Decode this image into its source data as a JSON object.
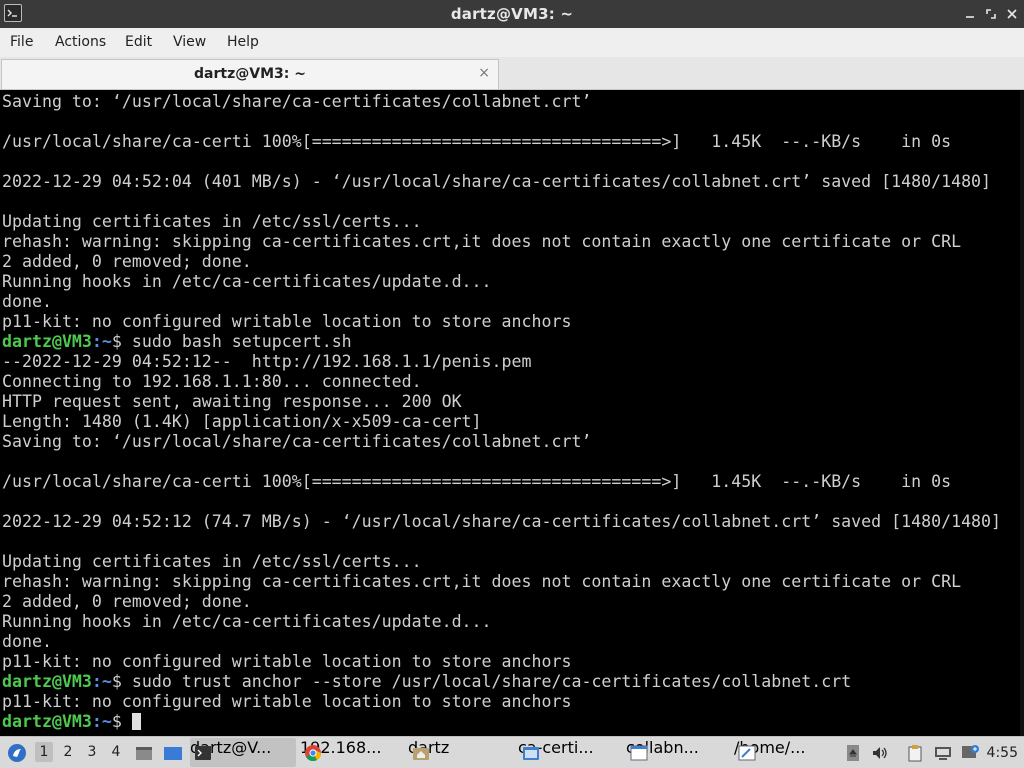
{
  "window": {
    "title": "dartz@VM3: ~"
  },
  "menubar": {
    "items": [
      "File",
      "Actions",
      "Edit",
      "View",
      "Help"
    ]
  },
  "tab": {
    "label": "dartz@VM3: ~",
    "close": "×"
  },
  "terminal": {
    "prompt_user": "dartz@VM3",
    "prompt_path": ":~",
    "prompt_symbol": "$ ",
    "lines": [
      {
        "text": "Saving to: ‘/usr/local/share/ca-certificates/collabnet.crt’"
      },
      {
        "text": ""
      },
      {
        "text": "/usr/local/share/ca-certi 100%[===================================>]   1.45K  --.-KB/s    in 0s"
      },
      {
        "text": ""
      },
      {
        "text": "2022-12-29 04:52:04 (401 MB/s) - ‘/usr/local/share/ca-certificates/collabnet.crt’ saved [1480/1480]"
      },
      {
        "text": ""
      },
      {
        "text": "Updating certificates in /etc/ssl/certs..."
      },
      {
        "text": "rehash: warning: skipping ca-certificates.crt,it does not contain exactly one certificate or CRL"
      },
      {
        "text": "2 added, 0 removed; done."
      },
      {
        "text": "Running hooks in /etc/ca-certificates/update.d..."
      },
      {
        "text": "done."
      },
      {
        "text": "p11-kit: no configured writable location to store anchors"
      },
      {
        "prompt": true,
        "text": "sudo bash setupcert.sh"
      },
      {
        "text": "--2022-12-29 04:52:12--  http://192.168.1.1/penis.pem"
      },
      {
        "text": "Connecting to 192.168.1.1:80... connected."
      },
      {
        "text": "HTTP request sent, awaiting response... 200 OK"
      },
      {
        "text": "Length: 1480 (1.4K) [application/x-x509-ca-cert]"
      },
      {
        "text": "Saving to: ‘/usr/local/share/ca-certificates/collabnet.crt’"
      },
      {
        "text": ""
      },
      {
        "text": "/usr/local/share/ca-certi 100%[===================================>]   1.45K  --.-KB/s    in 0s"
      },
      {
        "text": ""
      },
      {
        "text": "2022-12-29 04:52:12 (74.7 MB/s) - ‘/usr/local/share/ca-certificates/collabnet.crt’ saved [1480/1480]"
      },
      {
        "text": ""
      },
      {
        "text": "Updating certificates in /etc/ssl/certs..."
      },
      {
        "text": "rehash: warning: skipping ca-certificates.crt,it does not contain exactly one certificate or CRL"
      },
      {
        "text": "2 added, 0 removed; done."
      },
      {
        "text": "Running hooks in /etc/ca-certificates/update.d..."
      },
      {
        "text": "done."
      },
      {
        "text": "p11-kit: no configured writable location to store anchors"
      },
      {
        "prompt": true,
        "text": "sudo trust anchor --store /usr/local/share/ca-certificates/collabnet.crt"
      },
      {
        "text": "p11-kit: no configured writable location to store anchors"
      },
      {
        "prompt": true,
        "text": "",
        "cursor": true
      }
    ]
  },
  "taskbar": {
    "workspaces": [
      "1",
      "2",
      "3",
      "4"
    ],
    "active_workspace": "1",
    "tasks": [
      {
        "icon": "terminal-icon",
        "label": "dartz@V...",
        "active": true
      },
      {
        "icon": "chrome-icon",
        "label": "192.168..."
      },
      {
        "icon": "folder-home-icon",
        "label": "dartz"
      },
      {
        "icon": "folder-icon",
        "label": "ca-certi..."
      },
      {
        "icon": "text-editor-icon",
        "label": "collabn..."
      },
      {
        "icon": "text-editor-icon",
        "label": "/home/..."
      }
    ],
    "clock": "4:55"
  }
}
